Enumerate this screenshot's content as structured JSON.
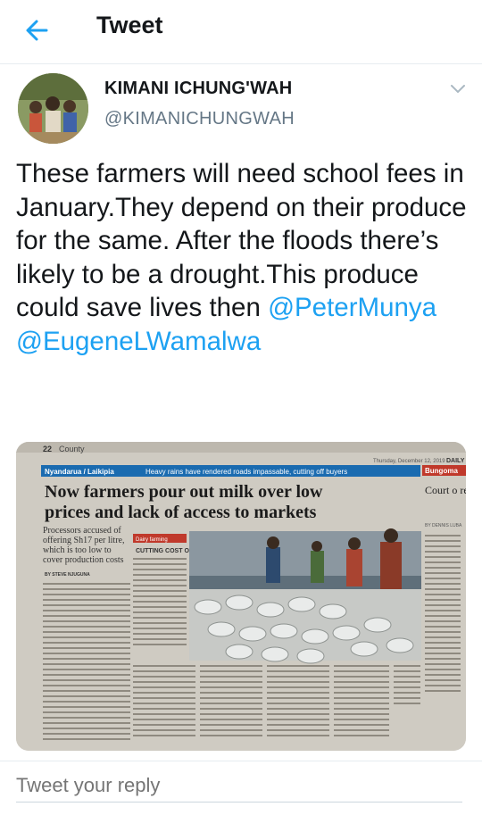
{
  "header": {
    "title": "Tweet",
    "back_icon": "back-arrow-icon"
  },
  "author": {
    "name": "KIMANI ICHUNG'WAH",
    "handle": "@KIMANICHUNGWAH"
  },
  "tweet": {
    "text": "These farmers will need school fees in January.They depend on their produce for the same. After the floods there’s likely to be a drought.This produce could save lives then ",
    "mention_1": "@PeterMunya",
    "mention_2": "@EugeneLWamalwa"
  },
  "media": {
    "page_number": "22",
    "section": "County",
    "date_line": "Thursday, December 12, 2019",
    "brand": "DAILY",
    "kicker": "Nyandarua / Laikipia",
    "kicker_note": "Heavy rains have rendered roads impassable, cutting off buyers",
    "headline_1": "Now farmers pour out milk over low",
    "headline_2": "prices and lack of access to markets",
    "summary": "Processors accused of offering Sh17 per litre, which is too low to cover production costs",
    "byline": "BY STEVE NJUGUNA",
    "sidebar_tag": "Dairy farming",
    "sidebar_title": "CUTTING COST OF PRODUCTION",
    "side_kicker": "Bungoma",
    "side_head": "Court o rehabilit of dum",
    "side_byline": "BY DENNIS LUBA"
  },
  "reply": {
    "placeholder": "Tweet your reply"
  },
  "colors": {
    "accent": "#1da1f2",
    "muted": "#657786",
    "text": "#14171a",
    "divider": "#e6ecf0"
  }
}
